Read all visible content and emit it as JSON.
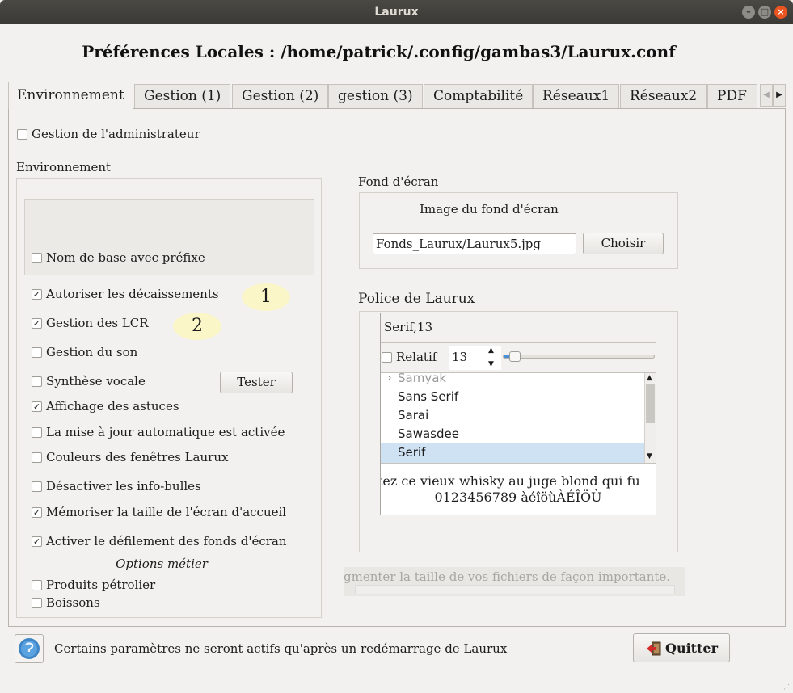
{
  "window": {
    "title": "Laurux"
  },
  "heading": "Préférences Locales : /home/patrick/.config/gambas3/Laurux.conf",
  "tabs": [
    "Environnement",
    "Gestion (1)",
    "Gestion (2)",
    "gestion (3)",
    "Comptabilité",
    "Réseaux1",
    "Réseaux2",
    "PDF"
  ],
  "admin": {
    "label": "Gestion de l'administrateur",
    "checked": false
  },
  "env": {
    "title": "Environnement",
    "nom_base": "Nom de base avec préfixe",
    "options": [
      {
        "label": "Autoriser les décaissements",
        "checked": true
      },
      {
        "label": "Gestion des LCR",
        "checked": true
      },
      {
        "label": "Gestion du son",
        "checked": false
      },
      {
        "label": "Synthèse vocale",
        "checked": false
      },
      {
        "label": "Affichage des astuces",
        "checked": true
      },
      {
        "label": "La mise à jour automatique est activée",
        "checked": false
      },
      {
        "label": "Couleurs des fenêtres Laurux",
        "checked": false
      },
      {
        "label": "Désactiver les info-bulles",
        "checked": false
      },
      {
        "label": "Mémoriser la taille de l'écran d'accueil",
        "checked": true
      },
      {
        "label": "Activer le défilement des fonds d'écran",
        "checked": true
      }
    ],
    "tester_label": "Tester",
    "options_metier": "Options métier",
    "metier": [
      {
        "label": "Produits pétrolier",
        "checked": false
      },
      {
        "label": "Boissons",
        "checked": false
      }
    ],
    "bubble1": "1",
    "bubble2": "2"
  },
  "fond": {
    "title": "Fond d'écran",
    "image_label": "Image du fond d'écran",
    "file_value": "Fonds_Laurux/Laurux5.jpg",
    "choose_label": "Choisir"
  },
  "police": {
    "title": "Police de Laurux",
    "current": "Serif,13",
    "relatif_label": "Relatif",
    "size_value": "13",
    "size_fraction": 0.08,
    "fonts": [
      "Samyak",
      "Sans Serif",
      "Sarai",
      "Sawasdee",
      "Serif"
    ],
    "selected": "Serif",
    "preview_line1": "tez ce vieux whisky au juge blond qui fu",
    "preview_line2": "0123456789 àéîöùÀÉÎÖÙ"
  },
  "hint_text": "gmenter la taille de vos fichiers de façon importante.",
  "footer": {
    "message": "Certains paramètres ne seront actifs qu'après un redémarrage de Laurux",
    "quit_label": "Quitter"
  },
  "colors": {
    "accent": "#e95420",
    "selection": "#cfe2f3"
  }
}
